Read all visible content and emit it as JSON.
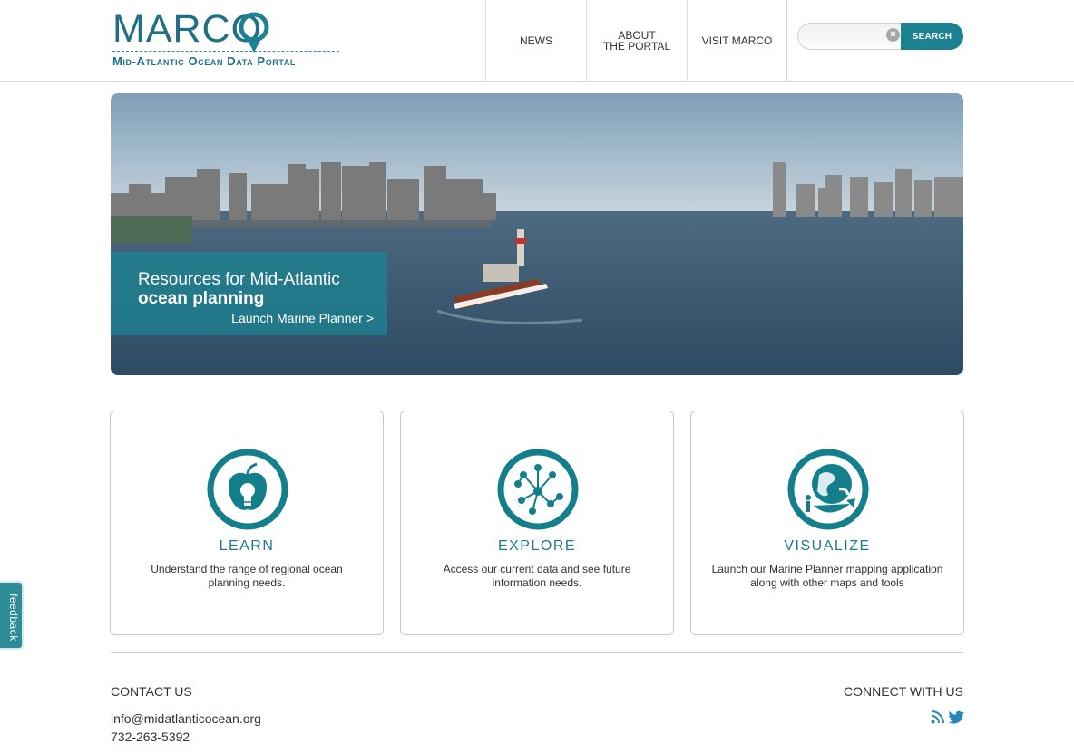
{
  "header": {
    "logo_word": "MARCO",
    "logo_subtitle": "Mid-Atlantic Ocean Data Portal",
    "nav": [
      {
        "label": "NEWS"
      },
      {
        "label_line1": "ABOUT",
        "label_line2": "THE PORTAL"
      },
      {
        "label": "VISIT MARCO"
      }
    ],
    "search": {
      "value": "",
      "placeholder": "",
      "button_label": "SEARCH"
    }
  },
  "hero": {
    "line1": "Resources for Mid-Atlantic",
    "line2": "ocean planning",
    "link": "Launch Marine Planner >"
  },
  "cards": [
    {
      "title": "LEARN",
      "description": "Understand the range of regional ocean planning needs.",
      "icon": "lightbulb-apple-icon"
    },
    {
      "title": "EXPLORE",
      "description": "Access our current data and see future information needs.",
      "icon": "network-icon"
    },
    {
      "title": "VISUALIZE",
      "description": "Launch our Marine Planner mapping application along with other maps and tools",
      "icon": "globe-person-icon"
    }
  ],
  "footer": {
    "contact_title": "CONTACT US",
    "email": "info@midatlanticocean.org",
    "phone": "732-263-5392",
    "connect_title": "CONNECT WITH US",
    "social_icons": [
      "rss-icon",
      "twitter-icon"
    ]
  },
  "feedback_label": "feedback",
  "colors": {
    "brand_teal": "#1c8191",
    "logo_blue": "#1f6f86",
    "card_title": "#1f7a8c"
  }
}
